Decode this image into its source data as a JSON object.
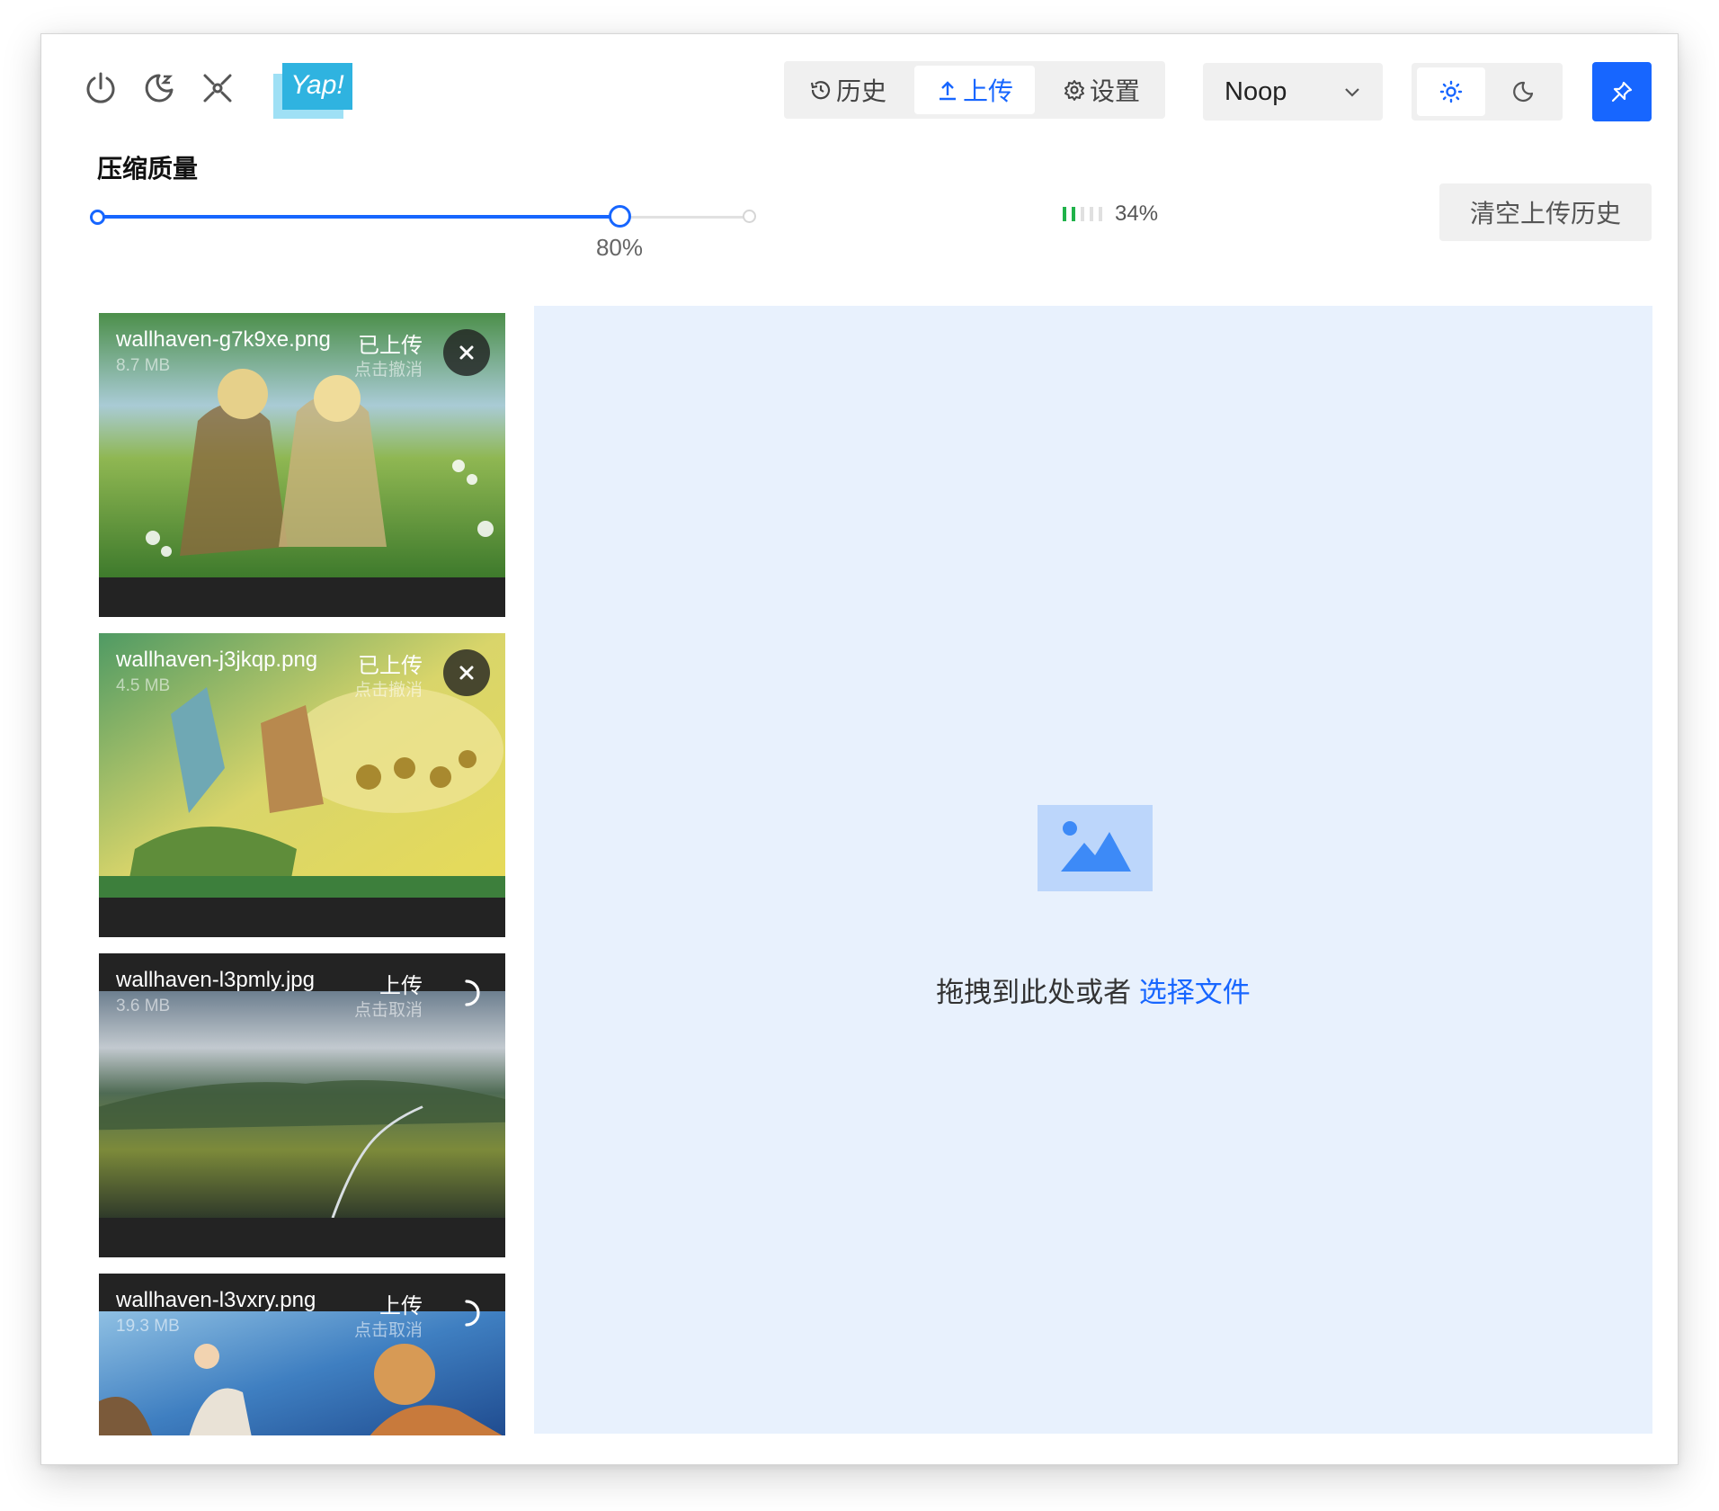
{
  "toolbar": {
    "window_icons": [
      "power-icon",
      "sleep-moon-icon",
      "debug-icon"
    ],
    "logo_text": "Yap!",
    "tabs": [
      {
        "label": "历史",
        "icon": "history-icon",
        "active": false
      },
      {
        "label": "上传",
        "icon": "upload-icon",
        "active": true
      },
      {
        "label": "设置",
        "icon": "settings-icon",
        "active": false
      }
    ],
    "uploader_select": {
      "value": "Noop"
    },
    "theme_options": [
      "sun-icon",
      "moon-icon"
    ],
    "theme_selected": "light",
    "pin_icon": "pin-icon",
    "accent_color": "#1766ff"
  },
  "quality": {
    "label": "压缩质量",
    "value_fraction": 0.8,
    "value_text": "80%"
  },
  "usage": {
    "bars_total": 5,
    "bars_active": 2,
    "percent_text": "34%",
    "active_color": "#20b24a"
  },
  "clear_button": "清空上传历史",
  "uploads": [
    {
      "name": "wallhaven-g7k9xe.png",
      "size": "8.7 MB",
      "status": "已上传",
      "action": "点击撤消",
      "state": "done"
    },
    {
      "name": "wallhaven-j3jkqp.png",
      "size": "4.5 MB",
      "status": "已上传",
      "action": "点击撤消",
      "state": "done"
    },
    {
      "name": "wallhaven-l3pmly.jpg",
      "size": "3.6 MB",
      "status": "上传",
      "action": "点击取消",
      "state": "uploading"
    },
    {
      "name": "wallhaven-l3vxry.png",
      "size": "19.3 MB",
      "status": "上传",
      "action": "点击取消",
      "state": "uploading"
    }
  ],
  "dropzone": {
    "icon": "image-placeholder-icon",
    "text": "拖拽到此处或者",
    "link": "选择文件"
  }
}
